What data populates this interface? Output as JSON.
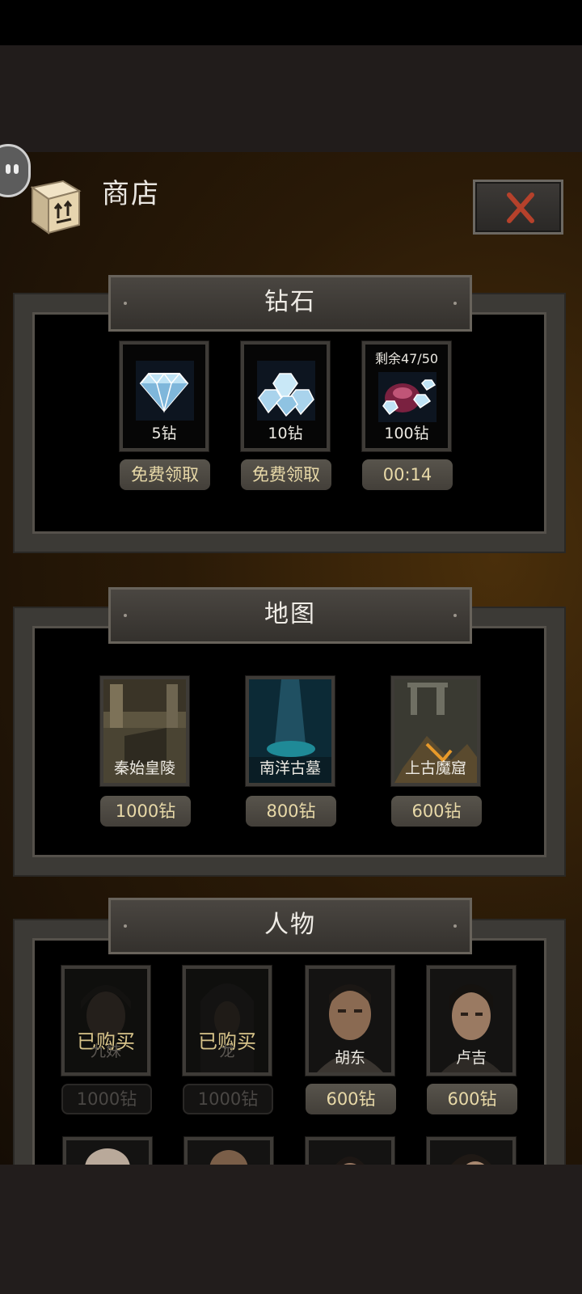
{
  "header": {
    "title": "商店"
  },
  "sections": {
    "diamonds": {
      "title": "钻石",
      "items": [
        {
          "amount_label": "5钻",
          "action_label": "免费领取"
        },
        {
          "amount_label": "10钻",
          "action_label": "免费领取"
        },
        {
          "amount_label": "100钻",
          "remaining_label": "剩余47/50",
          "timer": "00:14"
        }
      ]
    },
    "maps": {
      "title": "地图",
      "items": [
        {
          "name": "秦始皇陵",
          "price": "1000钻"
        },
        {
          "name": "南洋古墓",
          "price": "800钻"
        },
        {
          "name": "上古魔窟",
          "price": "600钻"
        }
      ]
    },
    "characters": {
      "title": "人物",
      "owned_label": "已购买",
      "items": [
        {
          "name": "九妹",
          "price": "1000钻",
          "owned": true
        },
        {
          "name": "龙",
          "price": "1000钻",
          "owned": true
        },
        {
          "name": "胡东",
          "price": "600钻",
          "owned": false
        },
        {
          "name": "卢吉",
          "price": "600钻",
          "owned": false
        }
      ]
    }
  },
  "colors": {
    "price_text": "#e8d9a8",
    "close_x": "#b5412b",
    "panel_frame": "#3c3a36"
  },
  "icons": {
    "header": "box-icon",
    "close": "close-icon",
    "float": "assistant-bubble-icon"
  }
}
